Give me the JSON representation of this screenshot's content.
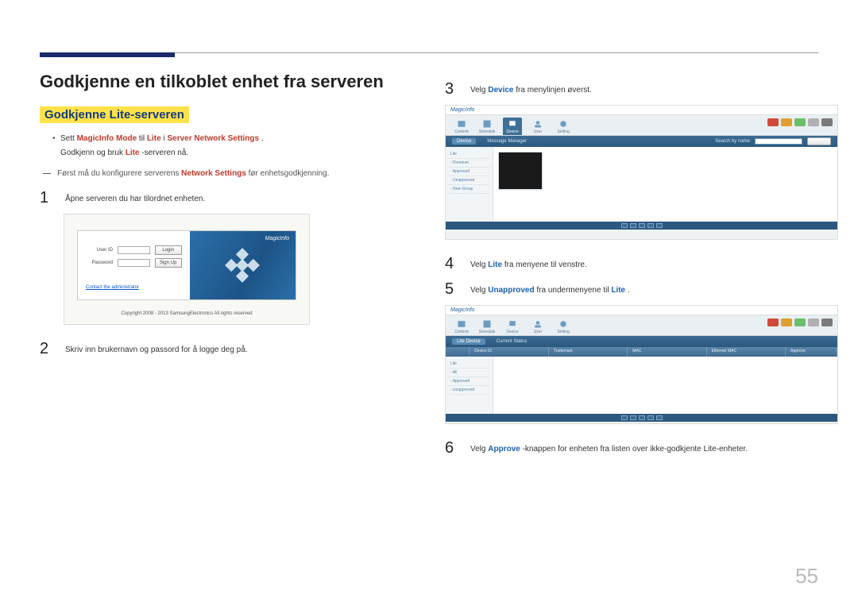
{
  "page_number": "55",
  "heading": "Godkjenne en tilkoblet enhet fra serveren",
  "subheading": "Godkjenne Lite-serveren",
  "bullet": {
    "pre": "Sett ",
    "hl1": "MagicInfo Mode",
    "mid1": " til ",
    "hl2": "Lite",
    "mid2": " i ",
    "hl3": "Server Network Settings",
    "post": "."
  },
  "bullet_line2_pre": "Godkjenn og bruk ",
  "bullet_line2_hl": "Lite",
  "bullet_line2_post": "-serveren nå.",
  "dash_note_pre": "Først må du konfigurere serverens ",
  "dash_note_hl": "Network Settings",
  "dash_note_post": " før enhetsgodkjenning.",
  "steps": {
    "s1": {
      "num": "1",
      "text": "Åpne serveren du har tilordnet enheten."
    },
    "s2": {
      "num": "2",
      "text": "Skriv inn brukernavn og passord for å logge deg på."
    },
    "s3": {
      "num": "3",
      "pre": "Velg ",
      "hl": "Device",
      "post": " fra menylinjen øverst."
    },
    "s4": {
      "num": "4",
      "pre": "Velg ",
      "hl": "Lite",
      "post": " fra menyene til venstre."
    },
    "s5": {
      "num": "5",
      "pre": "Velg ",
      "hl": "Unapproved",
      "mid": " fra undermenyene til ",
      "hl2": "Lite",
      "post": "."
    },
    "s6": {
      "num": "6",
      "pre": "Velg ",
      "hl": "Approve",
      "post": "-knappen for enheten fra listen over ikke-godkjente Lite-enheter."
    }
  },
  "login_shot": {
    "user_label": "User ID",
    "pass_label": "Password",
    "login_btn": "Login",
    "signup_btn": "Sign Up",
    "contact_link": "Contact the administrator",
    "brand": "MagicInfo",
    "copyright": "Copyright 2009 - 2013 SamsungElectronics All rights reserved"
  },
  "app_shot": {
    "brand": "MagicInfo",
    "top_icons": [
      "Content",
      "Schedule",
      "Device",
      "User",
      "Setting"
    ],
    "device_tabs_a": [
      "Device",
      "Message Manager"
    ],
    "device_tabs_b": [
      "Lite Device",
      "Current Status"
    ],
    "search_label": "Search by name",
    "export_label": "Export Excel",
    "sidebar_a": [
      "Lite",
      "- Premium",
      "- Approved",
      "- Unapproved",
      "- New Group"
    ],
    "sidebar_b": [
      "Lite",
      "- All",
      "- Approved",
      "- Unapproved"
    ],
    "headers_b": [
      "",
      "Device ID",
      "Trademark",
      "MAC",
      "Ethernet MAC",
      "Approve"
    ]
  }
}
